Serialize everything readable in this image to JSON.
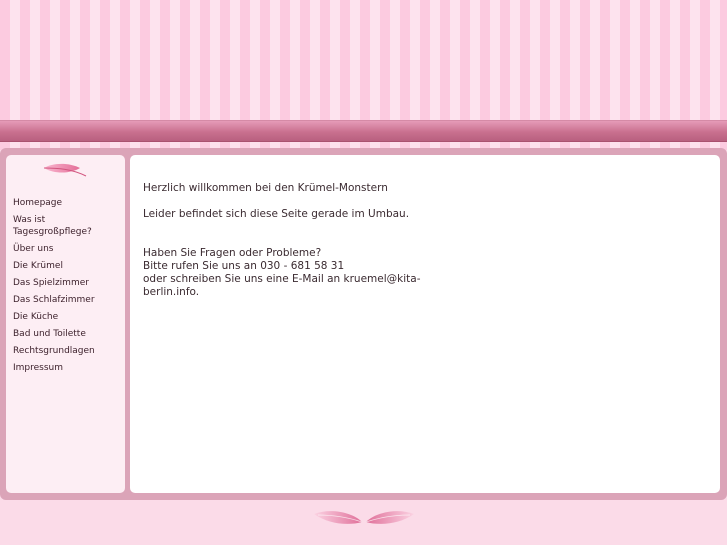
{
  "nav": {
    "items": [
      {
        "label": "Homepage"
      },
      {
        "label": "Was ist Tagesgroßpflege?"
      },
      {
        "label": "Über uns"
      },
      {
        "label": "Die Krümel"
      },
      {
        "label": "Das Spielzimmer"
      },
      {
        "label": "Das Schlafzimmer"
      },
      {
        "label": "Die Küche"
      },
      {
        "label": "Bad und Toilette"
      },
      {
        "label": "Rechtsgrundlagen"
      },
      {
        "label": "Impressum"
      }
    ]
  },
  "content": {
    "welcome": "Herzlich willkommen bei den Krümel-Monstern",
    "umbau": "Leider befindet sich diese Seite gerade im Umbau.",
    "questions": "Haben Sie Fragen oder Probleme?",
    "phone": "Bitte rufen Sie uns an 030 - 681 58 31",
    "email": "oder schreiben Sie uns eine E-Mail an kruemel@kita-berlin.info."
  },
  "icons": {
    "sidebar_top": "feather-icon",
    "footer": "wings-icon"
  },
  "colors": {
    "stripe_dark": "#fccbe0",
    "stripe_light": "#fde3ee",
    "band": "#c9708f",
    "frame": "#dba4b8",
    "sidebar_bg": "#fdeef4"
  }
}
